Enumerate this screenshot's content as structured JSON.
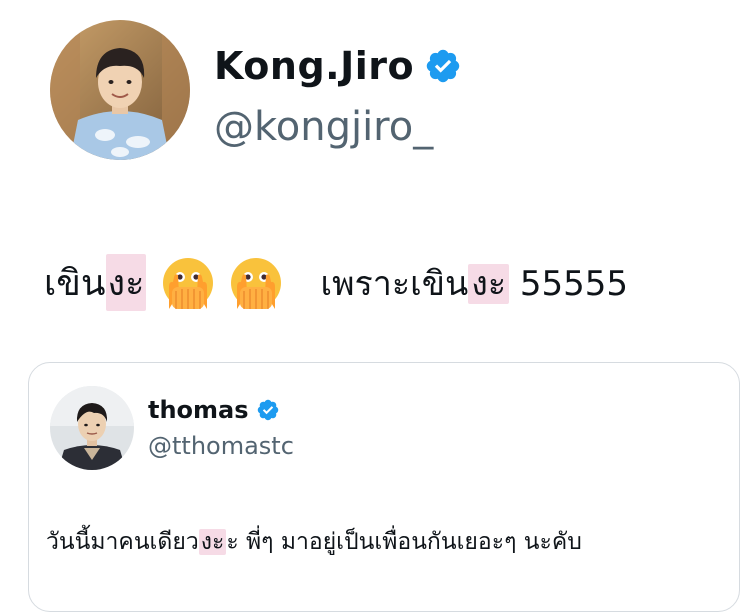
{
  "tweet": {
    "author": {
      "display_name": "Kong.Jiro",
      "handle": "@kongjiro_",
      "verified": true,
      "avatar_icon": "profile-photo-avatar"
    },
    "text_part1": "เขิน",
    "text_highlight1": "งะ",
    "emojis": [
      "face-with-open-eyes-and-hand-over-mouth-emoji",
      "face-with-open-eyes-and-hand-over-mouth-emoji"
    ],
    "text_part2": "เพราะเขิน",
    "text_highlight2": "งะ",
    "text_part3": " 55555"
  },
  "quoted_tweet": {
    "author": {
      "display_name": "thomas",
      "handle": "@tthomastc",
      "verified": true,
      "avatar_icon": "profile-photo-avatar"
    },
    "text_part1": "วันนี้มาคนเดียว",
    "text_highlight": "งะ",
    "text_part2": "ะ พี่ๆ มาอยู่เป็นเพื่อนกันเยอะๆ นะคับ"
  },
  "colors": {
    "verified_badge": "#1d9bf0",
    "handle_gray": "#536471",
    "highlight_pink": "#f6dbe6",
    "card_border": "#d6dbe0"
  }
}
